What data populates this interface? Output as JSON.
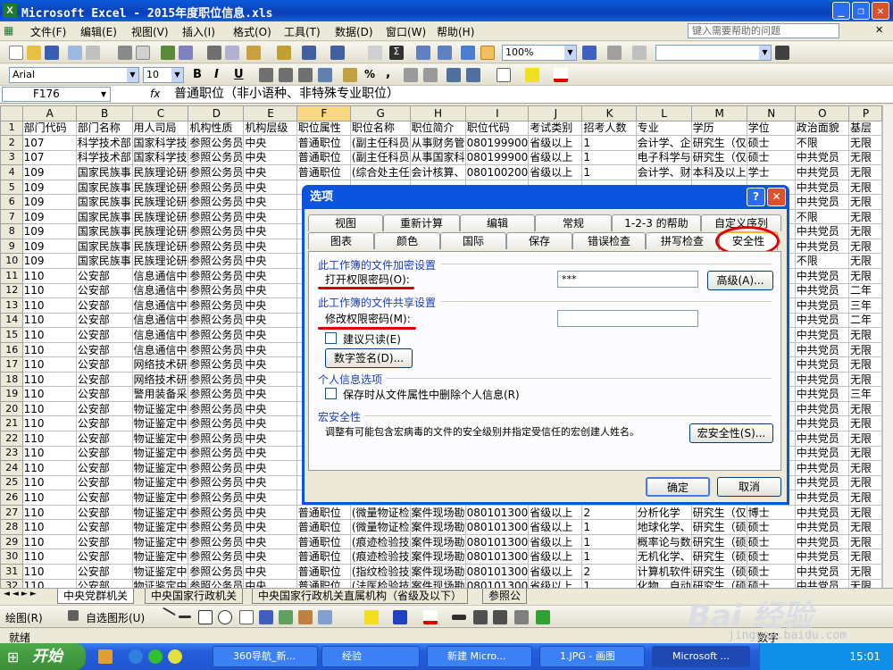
{
  "window": {
    "title": "Microsoft Excel - 2015年度职位信息.xls",
    "min": "_",
    "max": "❐",
    "close": "✕"
  },
  "menu": {
    "items": [
      "文件(F)",
      "编辑(E)",
      "视图(V)",
      "插入(I)",
      "格式(O)",
      "工具(T)",
      "数据(D)",
      "窗口(W)",
      "帮助(H)"
    ],
    "help_placeholder": "键入需要帮助的问题",
    "doc_close": "✕"
  },
  "toolbar": {
    "zoom": "100%",
    "font": "Arial",
    "size": "10",
    "bold": "B",
    "italic": "I",
    "underline": "U",
    "percent": "%",
    "comma": ","
  },
  "formula_bar": {
    "cell_ref": "F176",
    "fx": "fx",
    "content": "普通职位（非小语种、非特殊专业职位）"
  },
  "columns": [
    "",
    "A",
    "B",
    "C",
    "D",
    "E",
    "F",
    "G",
    "H",
    "I",
    "J",
    "K",
    "L",
    "M",
    "N",
    "O",
    "P"
  ],
  "rows": [
    {
      "n": "1",
      "c": [
        "部门代码",
        "部门名称",
        "用人司局",
        "机构性质",
        "机构层级",
        "职位属性",
        "职位名称",
        "职位简介",
        "职位代码",
        "考试类别",
        "招考人数",
        "专业",
        "学历",
        "学位",
        "政治面貌",
        "基层"
      ]
    },
    {
      "n": "2",
      "c": [
        "107",
        "科学技术部",
        "国家科学技",
        "参照公务员",
        "中央",
        "普通职位",
        "(副主任科员",
        "从事财务管",
        "080199900",
        "省级以上",
        "1",
        "会计学、企",
        "研究生（仅",
        "硕士",
        "不限",
        "无限"
      ]
    },
    {
      "n": "3",
      "c": [
        "107",
        "科学技术部",
        "国家科学技",
        "参照公务员",
        "中央",
        "普通职位",
        "(副主任科员",
        "从事国家科",
        "080199900",
        "省级以上",
        "1",
        "电子科学与",
        "研究生（仅",
        "硕士",
        "中共党员",
        "无限"
      ]
    },
    {
      "n": "4",
      "c": [
        "109",
        "国家民族事",
        "民族理论研",
        "参照公务员",
        "中央",
        "普通职位",
        "(综合处主任",
        "会计核算、",
        "080100200",
        "省级以上",
        "1",
        "会计学、财",
        "本科及以上",
        "学士",
        "中共党员",
        "无限"
      ]
    },
    {
      "n": "5",
      "c": [
        "109",
        "国家民族事",
        "民族理论研",
        "参照公务员",
        "中央",
        "",
        "",
        "",
        "",
        "",
        "",
        "",
        "",
        "",
        "中共党员",
        "无限"
      ]
    },
    {
      "n": "6",
      "c": [
        "109",
        "国家民族事",
        "民族理论研",
        "参照公务员",
        "中央",
        "",
        "",
        "",
        "",
        "",
        "",
        "",
        "",
        "",
        "中共党员",
        "无限"
      ]
    },
    {
      "n": "7",
      "c": [
        "109",
        "国家民族事",
        "民族理论研",
        "参照公务员",
        "中央",
        "",
        "",
        "",
        "",
        "",
        "",
        "",
        "",
        "",
        "不限",
        "无限"
      ]
    },
    {
      "n": "8",
      "c": [
        "109",
        "国家民族事",
        "民族理论研",
        "参照公务员",
        "中央",
        "",
        "",
        "",
        "",
        "",
        "",
        "",
        "",
        "",
        "中共党员",
        "无限"
      ]
    },
    {
      "n": "9",
      "c": [
        "109",
        "国家民族事",
        "民族理论研",
        "参照公务员",
        "中央",
        "",
        "",
        "",
        "",
        "",
        "",
        "",
        "",
        "",
        "中共党员",
        "无限"
      ]
    },
    {
      "n": "10",
      "c": [
        "109",
        "国家民族事",
        "民族理论研",
        "参照公务员",
        "中央",
        "",
        "",
        "",
        "",
        "",
        "",
        "",
        "",
        "",
        "不限",
        "无限"
      ]
    },
    {
      "n": "11",
      "c": [
        "110",
        "公安部",
        "信息通信中",
        "参照公务员",
        "中央",
        "",
        "",
        "",
        "",
        "",
        "",
        "",
        "",
        "",
        "中共党员",
        "无限"
      ]
    },
    {
      "n": "12",
      "c": [
        "110",
        "公安部",
        "信息通信中",
        "参照公务员",
        "中央",
        "",
        "",
        "",
        "",
        "",
        "",
        "",
        "",
        "",
        "中共党员",
        "二年"
      ]
    },
    {
      "n": "13",
      "c": [
        "110",
        "公安部",
        "信息通信中",
        "参照公务员",
        "中央",
        "",
        "",
        "",
        "",
        "",
        "",
        "",
        "",
        "",
        "中共党员",
        "三年"
      ]
    },
    {
      "n": "14",
      "c": [
        "110",
        "公安部",
        "信息通信中",
        "参照公务员",
        "中央",
        "",
        "",
        "",
        "",
        "",
        "",
        "",
        "",
        "",
        "中共党员",
        "二年"
      ]
    },
    {
      "n": "15",
      "c": [
        "110",
        "公安部",
        "信息通信中",
        "参照公务员",
        "中央",
        "",
        "",
        "",
        "",
        "",
        "",
        "",
        "",
        "",
        "中共党员",
        "无限"
      ]
    },
    {
      "n": "16",
      "c": [
        "110",
        "公安部",
        "信息通信中",
        "参照公务员",
        "中央",
        "",
        "",
        "",
        "",
        "",
        "",
        "",
        "",
        "",
        "中共党员",
        "无限"
      ]
    },
    {
      "n": "17",
      "c": [
        "110",
        "公安部",
        "网络技术研",
        "参照公务员",
        "中央",
        "",
        "",
        "",
        "",
        "",
        "",
        "",
        "",
        "",
        "中共党员",
        "无限"
      ]
    },
    {
      "n": "18",
      "c": [
        "110",
        "公安部",
        "网络技术研",
        "参照公务员",
        "中央",
        "",
        "",
        "",
        "",
        "",
        "",
        "",
        "",
        "",
        "中共党员",
        "无限"
      ]
    },
    {
      "n": "19",
      "c": [
        "110",
        "公安部",
        "警用装备采",
        "参照公务员",
        "中央",
        "",
        "",
        "",
        "",
        "",
        "",
        "",
        "",
        "",
        "中共党员",
        "三年"
      ]
    },
    {
      "n": "20",
      "c": [
        "110",
        "公安部",
        "物证鉴定中",
        "参照公务员",
        "中央",
        "",
        "",
        "",
        "",
        "",
        "",
        "",
        "",
        "",
        "中共党员",
        "无限"
      ]
    },
    {
      "n": "21",
      "c": [
        "110",
        "公安部",
        "物证鉴定中",
        "参照公务员",
        "中央",
        "",
        "",
        "",
        "",
        "",
        "",
        "",
        "",
        "",
        "中共党员",
        "无限"
      ]
    },
    {
      "n": "22",
      "c": [
        "110",
        "公安部",
        "物证鉴定中",
        "参照公务员",
        "中央",
        "",
        "",
        "",
        "",
        "",
        "",
        "",
        "",
        "",
        "中共党员",
        "无限"
      ]
    },
    {
      "n": "23",
      "c": [
        "110",
        "公安部",
        "物证鉴定中",
        "参照公务员",
        "中央",
        "",
        "",
        "",
        "",
        "",
        "",
        "",
        "",
        "",
        "中共党员",
        "无限"
      ]
    },
    {
      "n": "24",
      "c": [
        "110",
        "公安部",
        "物证鉴定中",
        "参照公务员",
        "中央",
        "",
        "",
        "",
        "",
        "",
        "",
        "",
        "",
        "",
        "中共党员",
        "无限"
      ]
    },
    {
      "n": "25",
      "c": [
        "110",
        "公安部",
        "物证鉴定中",
        "参照公务员",
        "中央",
        "",
        "",
        "",
        "",
        "",
        "",
        "",
        "",
        "",
        "中共党员",
        "无限"
      ]
    },
    {
      "n": "26",
      "c": [
        "110",
        "公安部",
        "物证鉴定中",
        "参照公务员",
        "中央",
        "",
        "",
        "",
        "",
        "",
        "",
        "",
        "",
        "",
        "中共党员",
        "无限"
      ]
    },
    {
      "n": "27",
      "c": [
        "110",
        "公安部",
        "物证鉴定中",
        "参照公务员",
        "中央",
        "普通职位",
        "(微量物证检",
        "案件现场勘",
        "080101300",
        "省级以上",
        "2",
        "分析化学",
        "研究生（仅",
        "博士",
        "中共党员",
        "无限"
      ]
    },
    {
      "n": "28",
      "c": [
        "110",
        "公安部",
        "物证鉴定中",
        "参照公务员",
        "中央",
        "普通职位",
        "(微量物证检",
        "案件现场勘",
        "080101300",
        "省级以上",
        "1",
        "地球化学、",
        "研究生（硕",
        "硕士",
        "中共党员",
        "无限"
      ]
    },
    {
      "n": "29",
      "c": [
        "110",
        "公安部",
        "物证鉴定中",
        "参照公务员",
        "中央",
        "普通职位",
        "(痕迹检验技",
        "案件现场勘",
        "080101300",
        "省级以上",
        "1",
        "概率论与数",
        "研究生（硕",
        "硕士",
        "中共党员",
        "无限"
      ]
    },
    {
      "n": "30",
      "c": [
        "110",
        "公安部",
        "物证鉴定中",
        "参照公务员",
        "中央",
        "普通职位",
        "(痕迹检验技",
        "案件现场勘",
        "080101300",
        "省级以上",
        "1",
        "无机化学、",
        "研究生（硕",
        "硕士",
        "中共党员",
        "无限"
      ]
    },
    {
      "n": "31",
      "c": [
        "110",
        "公安部",
        "物证鉴定中",
        "参照公务员",
        "中央",
        "普通职位",
        "(指纹检验技",
        "案件现场勘",
        "080101300",
        "省级以上",
        "2",
        "计算机软件",
        "研究生（硕",
        "硕士",
        "中共党员",
        "无限"
      ]
    },
    {
      "n": "32",
      "c": [
        "110",
        "公安部",
        "物证鉴定中",
        "参照公务员",
        "中央",
        "普通职位",
        "(法医检验技",
        "案件现场勘",
        "080101300",
        "省级以上",
        "1",
        "化物、自动",
        "研究生（硕",
        "硕士",
        "中共党员",
        "无限"
      ]
    }
  ],
  "sheet_tabs": [
    "中央党群机关",
    "中央国家行政机关",
    "中央国家行政机关直属机构（省级及以下）",
    "参照公"
  ],
  "drawing_toolbar": {
    "draw": "绘图(R)",
    "autoshapes": "自选图形(U)"
  },
  "status": {
    "left": "就绪",
    "right": "数字"
  },
  "taskbar": {
    "start": "开始",
    "tasks": [
      "360导航_新...",
      "经验",
      "新建 Micro...",
      "1.JPG - 画图",
      "Microsoft ..."
    ],
    "time": "15:01"
  },
  "dialog": {
    "title": "选项",
    "help": "?",
    "close": "✕",
    "tabs_row1": [
      "视图",
      "重新计算",
      "编辑",
      "常规",
      "1-2-3 的帮助",
      "自定义序列"
    ],
    "tabs_row2": [
      "图表",
      "颜色",
      "国际",
      "保存",
      "错误检查",
      "拼写检查",
      "安全性"
    ],
    "encrypt_group": "此工作簿的文件加密设置",
    "open_pwd_label": "打开权限密码(O):",
    "open_pwd_value": "***",
    "advanced_btn": "高级(A)...",
    "share_group": "此工作簿的文件共享设置",
    "modify_pwd_label": "修改权限密码(M):",
    "modify_pwd_value": "",
    "readonly_label": "建议只读(E)",
    "digital_sig_btn": "数字签名(D)...",
    "privacy_group": "个人信息选项",
    "remove_info_label": "保存时从文件属性中删除个人信息(R)",
    "macro_group": "宏安全性",
    "macro_desc": "调整有可能包含宏病毒的文件的安全级别并指定受信任的宏创建人姓名。",
    "macro_btn": "宏安全性(S)...",
    "ok": "确定",
    "cancel": "取消"
  },
  "watermark": {
    "logo": "Bai 经验",
    "url": "jingyan.baidu.com"
  },
  "colors": {
    "titlebar": "#0a54e0",
    "selected_tab": "#f8b32a",
    "annotation": "#d40000"
  }
}
